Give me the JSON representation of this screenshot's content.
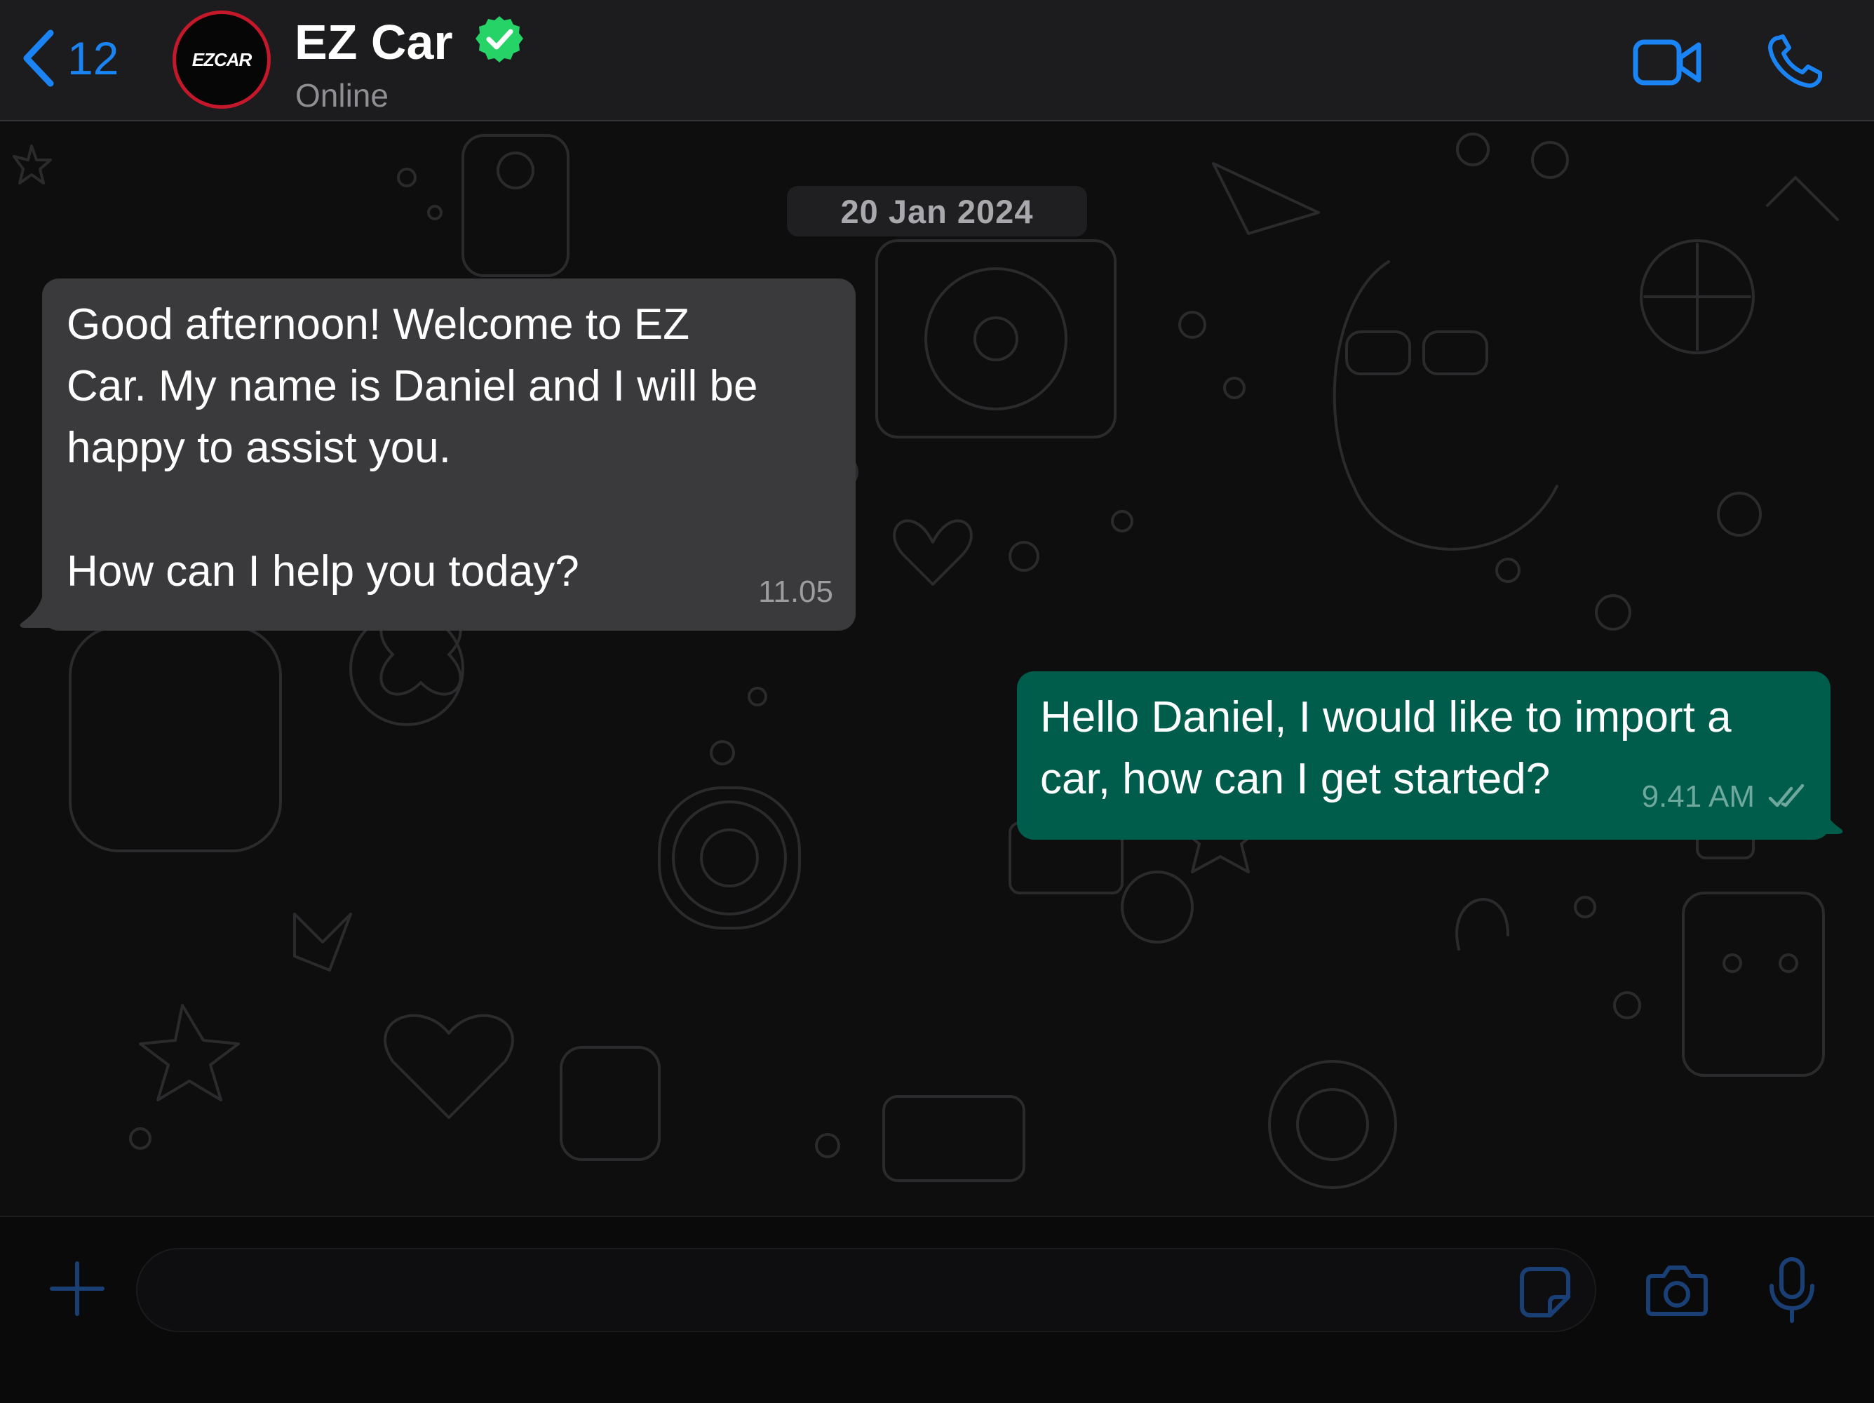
{
  "header": {
    "back_count": "12",
    "avatar_logo_text": "EZCAR",
    "contact_name": "EZ Car",
    "status": "Online",
    "icons": [
      "chevron-left-icon",
      "verified-badge-icon",
      "video-call-icon",
      "phone-call-icon"
    ]
  },
  "chat": {
    "date_label": "20 Jan 2024",
    "messages": [
      {
        "direction": "incoming",
        "text": "Good afternoon! Welcome to EZ\nCar. My name is Daniel and I will be\nhappy to assist you.\n\nHow can I help you today?",
        "time": "11.05"
      },
      {
        "direction": "outgoing",
        "text": "Hello Daniel, I would like to import a\ncar, how can I get started?",
        "time": "9.41 AM",
        "status_icon": "double-check-read-icon"
      }
    ]
  },
  "input_bar": {
    "placeholder": "",
    "icons": [
      "plus-icon",
      "sticker-icon",
      "camera-icon",
      "microphone-icon"
    ]
  },
  "colors": {
    "accent": "#1a84f5",
    "incoming_bubble": "#3a3a3c",
    "outgoing_bubble": "#005c4b",
    "verified": "#25d366",
    "avatar_ring": "#c5182b",
    "header_bg": "#1c1c1e"
  }
}
